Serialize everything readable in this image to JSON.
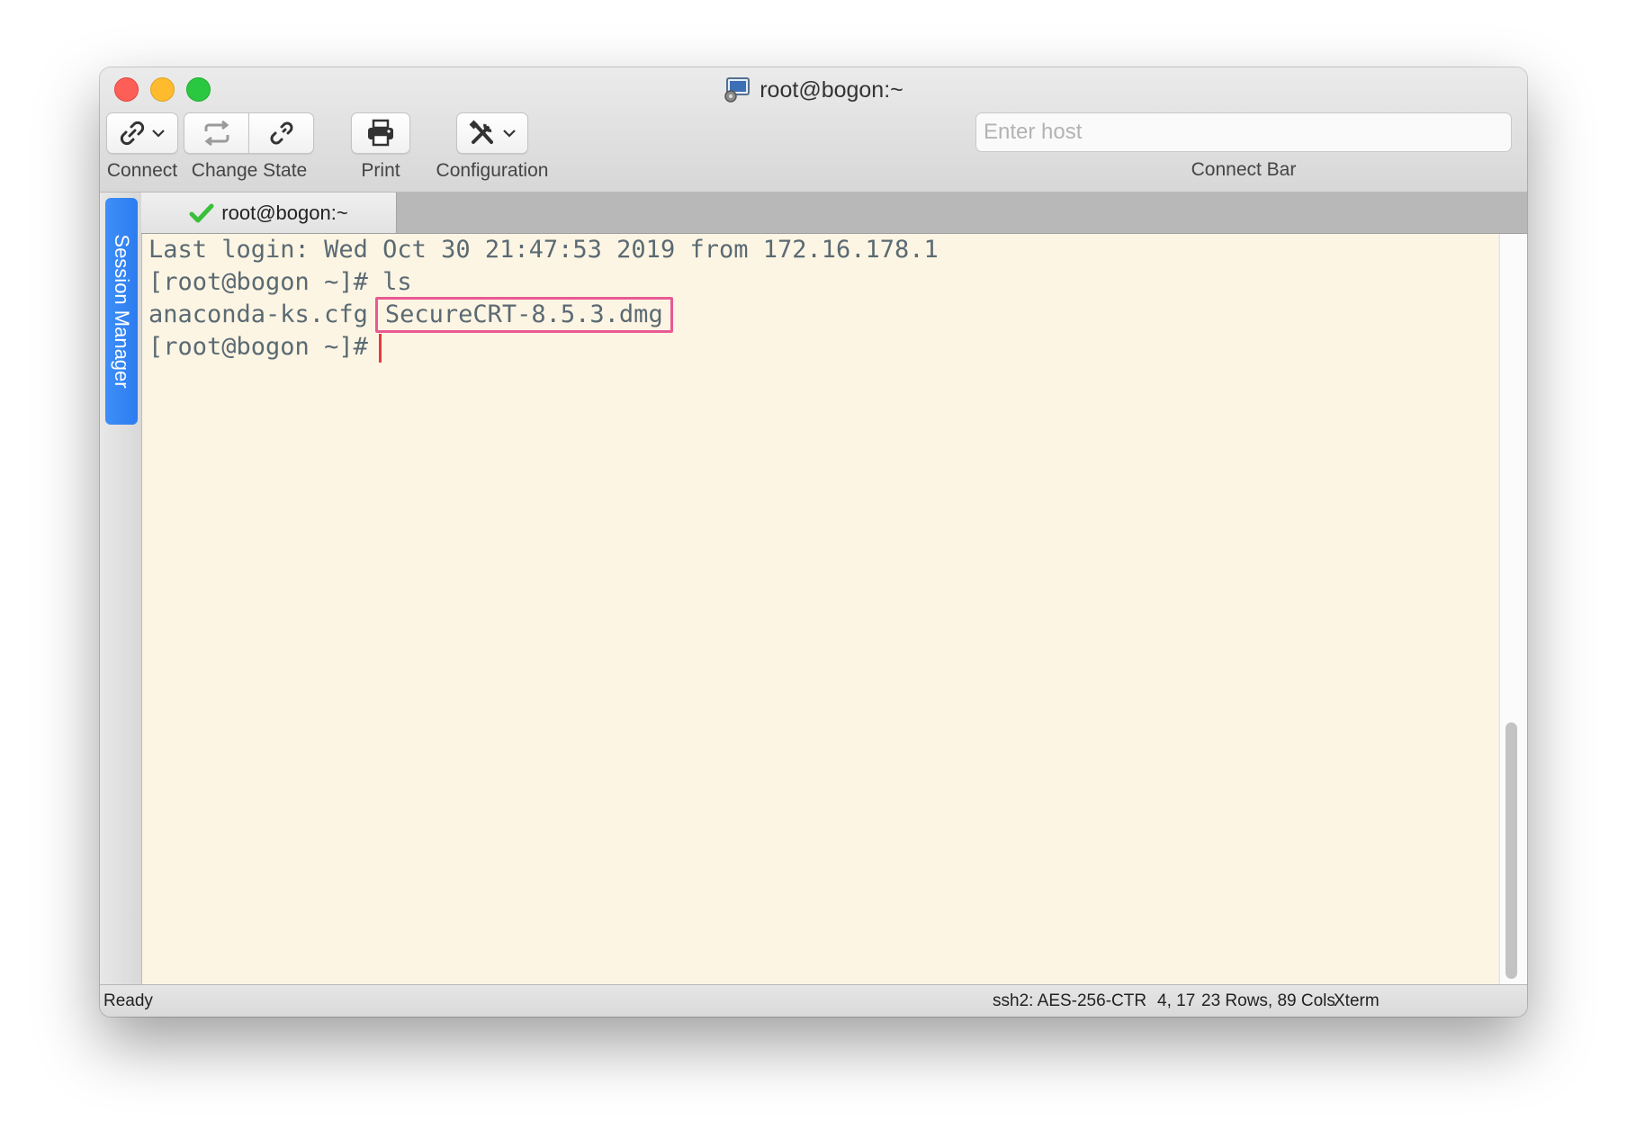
{
  "window": {
    "title": "root@bogon:~"
  },
  "toolbar": {
    "connect_label": "Connect",
    "change_state_label": "Change State",
    "print_label": "Print",
    "configuration_label": "Configuration"
  },
  "connect_bar": {
    "placeholder": "Enter host",
    "label": "Connect Bar"
  },
  "sidebar": {
    "session_manager_label": "Session Manager"
  },
  "tabs": [
    {
      "label": "root@bogon:~",
      "status_icon": "check-icon",
      "active": true
    }
  ],
  "terminal": {
    "lines": [
      "Last login: Wed Oct 30 21:47:53 2019 from 172.16.178.1",
      "[root@bogon ~]# ls"
    ],
    "listing": {
      "file1": "anaconda-ks.cfg",
      "file2_highlighted": "SecureCRT-8.5.3.dmg"
    },
    "prompt": "[root@bogon ~]#"
  },
  "status": {
    "state": "Ready",
    "cipher": "ssh2: AES-256-CTR",
    "cursor_pos": "4, 17",
    "size": "23 Rows, 89 Cols",
    "emulation": "Xterm"
  },
  "colors": {
    "terminal_bg": "#fdf5e3",
    "terminal_fg": "#5a6a73",
    "highlight_box": "#e85a93",
    "cursor": "#e03c3c",
    "session_manager_tab": "#2c7cf0"
  }
}
